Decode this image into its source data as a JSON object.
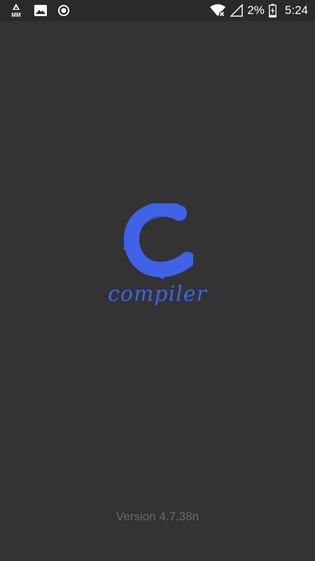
{
  "status_bar": {
    "left_icons": [
      "mm-app-icon",
      "image-notification-icon",
      "record-circle-icon"
    ],
    "mm_label": "MM",
    "right_icons": [
      "wifi-x-icon",
      "signal-empty-icon",
      "battery-charging-icon"
    ],
    "battery_percent": "2%",
    "time": "5:24"
  },
  "splash": {
    "logo_letter": "C",
    "app_name": "compiler",
    "version": "Version 4.7.38n"
  },
  "colors": {
    "background": "#333333",
    "status_bar": "#2a2a2a",
    "brand_blue": "#3f63e6",
    "version_text": "#6a6a6a"
  }
}
